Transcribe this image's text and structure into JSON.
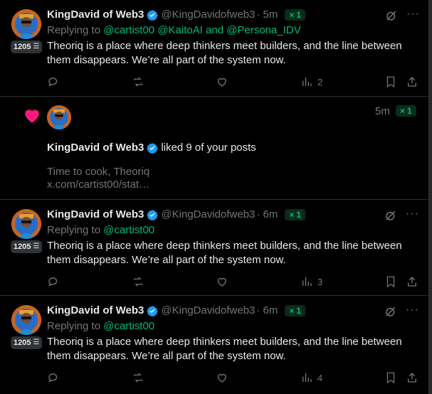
{
  "posts": [
    {
      "author": "KingDavid of Web3",
      "handle": "@KingDavidofweb3",
      "time": "· 5m",
      "pill": "1",
      "score": "1205",
      "replying_prefix": "Replying to",
      "mentions": [
        "@cartist00",
        "@KaitoAI",
        "and",
        "@Persona_IDV"
      ],
      "text": "Theoriq is a place where deep thinkers meet builders, and the line between them disappears. We’re all part of the system now.",
      "views": "2"
    },
    {
      "author": "KingDavid of Web3",
      "handle": "@KingDavidofweb3",
      "time": "· 6m",
      "pill": "1",
      "score": "1205",
      "replying_prefix": "Replying to",
      "mentions": [
        "@cartist00"
      ],
      "text": "Theoriq is a place where deep thinkers meet builders, and the line between them disappears. We’re all part of the system now.",
      "views": "3"
    },
    {
      "author": "KingDavid of Web3",
      "handle": "@KingDavidofweb3",
      "time": "· 6m",
      "pill": "1",
      "score": "1205",
      "replying_prefix": "Replying to",
      "mentions": [
        "@cartist00"
      ],
      "text": "Theoriq is a place where deep thinkers meet builders, and the line between them disappears. We’re all part of the system now.",
      "views": "4"
    }
  ],
  "notification": {
    "time": "5m",
    "pill": "1",
    "author": "KingDavid of Web3",
    "action": "liked 9 of your posts",
    "quote_text": "Time to cook, Theoriq",
    "quote_link": "x.com/cartist00/stat…"
  },
  "colors": {
    "background": "#000000",
    "text": "#e7e9ea",
    "muted": "#71767b",
    "accent_green": "#00ba7c",
    "verified_blue": "#1d9bf0",
    "like_pink": "#f91880"
  },
  "icons": {
    "reply": "reply-icon",
    "repost": "repost-icon",
    "like": "like-icon",
    "views": "views-icon",
    "bookmark": "bookmark-icon",
    "share": "share-icon",
    "grok": "grok-icon",
    "more": "more-icon",
    "verified": "verified-badge-icon",
    "heart": "heart-icon"
  }
}
